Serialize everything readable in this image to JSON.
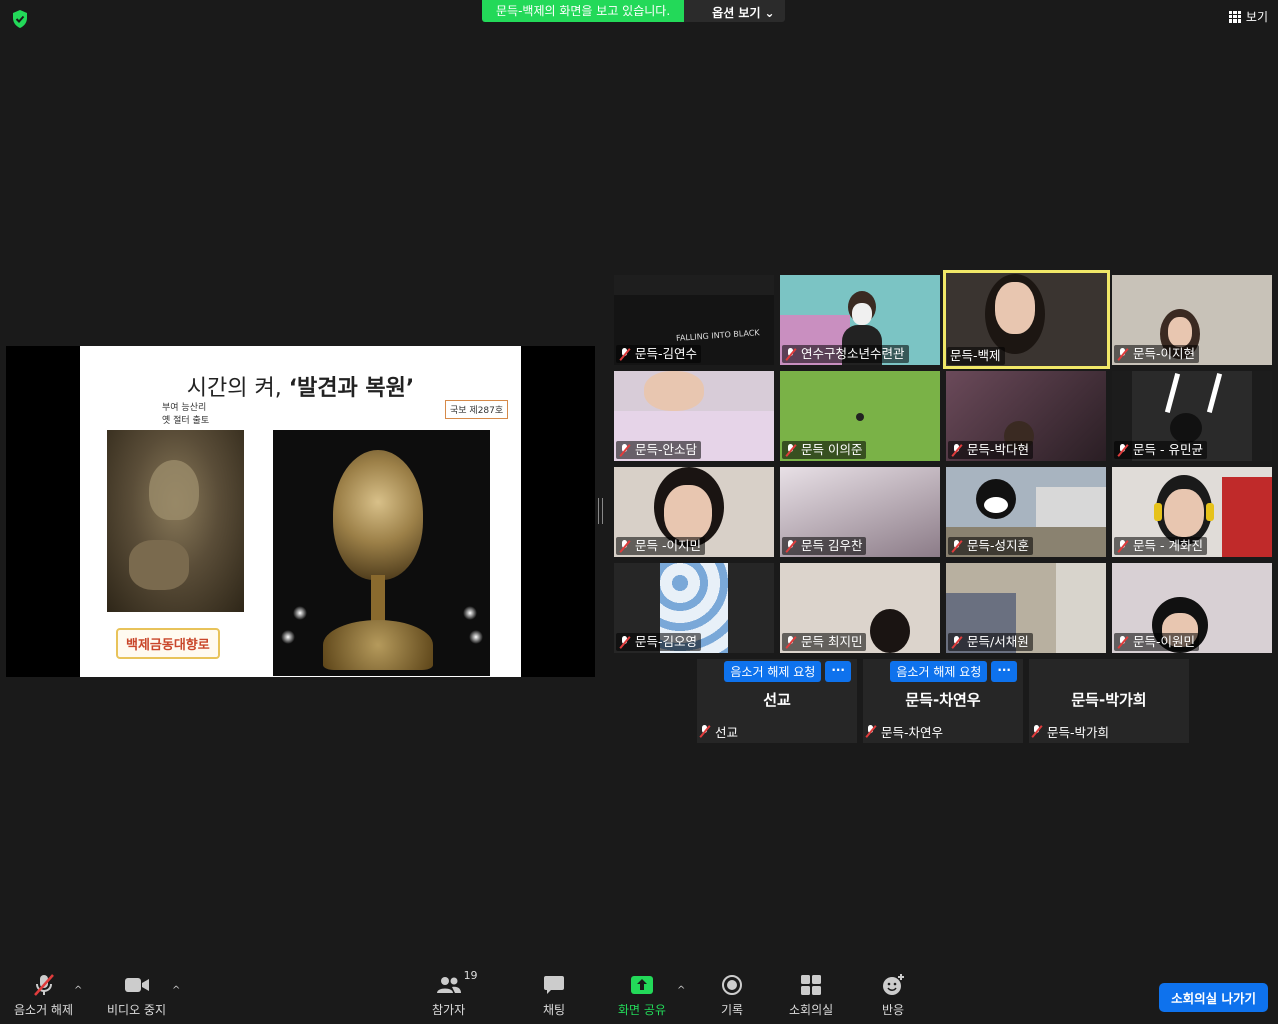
{
  "banner": {
    "sharing_text": "문득-백제의 화면을 보고 있습니다.",
    "options_label": "옵션 보기"
  },
  "view_button": {
    "label": "보기"
  },
  "slide": {
    "title_plain": "시간의 켜, ",
    "title_bold": "‘발견과 복원’",
    "left_caption_line1": "부여 능산리",
    "left_caption_line2": "옛 절터 출토",
    "right_caption": "국보 제287호",
    "bottom_label": "백제금동대향로"
  },
  "participants": [
    {
      "name": "문득-김연수",
      "muted": true
    },
    {
      "name": "연수구청소년수련관",
      "muted": true
    },
    {
      "name": "문득-백제",
      "muted": false,
      "active_speaker": true
    },
    {
      "name": "문득-이지현",
      "muted": true
    },
    {
      "name": "문득-안소담",
      "muted": true
    },
    {
      "name": "문득 이의준",
      "muted": true
    },
    {
      "name": "문득-박다현",
      "muted": true
    },
    {
      "name": "문득 - 유민균",
      "muted": true
    },
    {
      "name": "문득 -이지민",
      "muted": true
    },
    {
      "name": "문득 김우찬",
      "muted": true
    },
    {
      "name": "문득-성지훈",
      "muted": true
    },
    {
      "name": "문득 - 계화진",
      "muted": true
    },
    {
      "name": "문득-김오영",
      "muted": true
    },
    {
      "name": "문득 최지민",
      "muted": true
    },
    {
      "name": "문득/서채원",
      "muted": true
    },
    {
      "name": "문득-이원민",
      "muted": true
    }
  ],
  "no_video": [
    {
      "display": "선교",
      "name": "선교",
      "request_label": "음소거 해제 요청",
      "more_label": "···"
    },
    {
      "display": "문득-차연우",
      "name": "문득-차연우",
      "request_label": "음소거 해제 요청",
      "more_label": "···"
    },
    {
      "display": "문득-박가희",
      "name": "문득-박가희"
    }
  ],
  "toolbar": {
    "unmute": "음소거 해제",
    "stop_video": "비디오 중지",
    "participants": "참가자",
    "participants_count": "19",
    "chat": "채팅",
    "share": "화면 공유",
    "record": "기록",
    "breakout": "소회의실",
    "reactions": "반응",
    "leave_breakout": "소회의실 나가기"
  },
  "colors": {
    "share_green": "#23d959",
    "zoom_blue": "#0e72ed",
    "speaker_yellow": "#f1e868"
  }
}
